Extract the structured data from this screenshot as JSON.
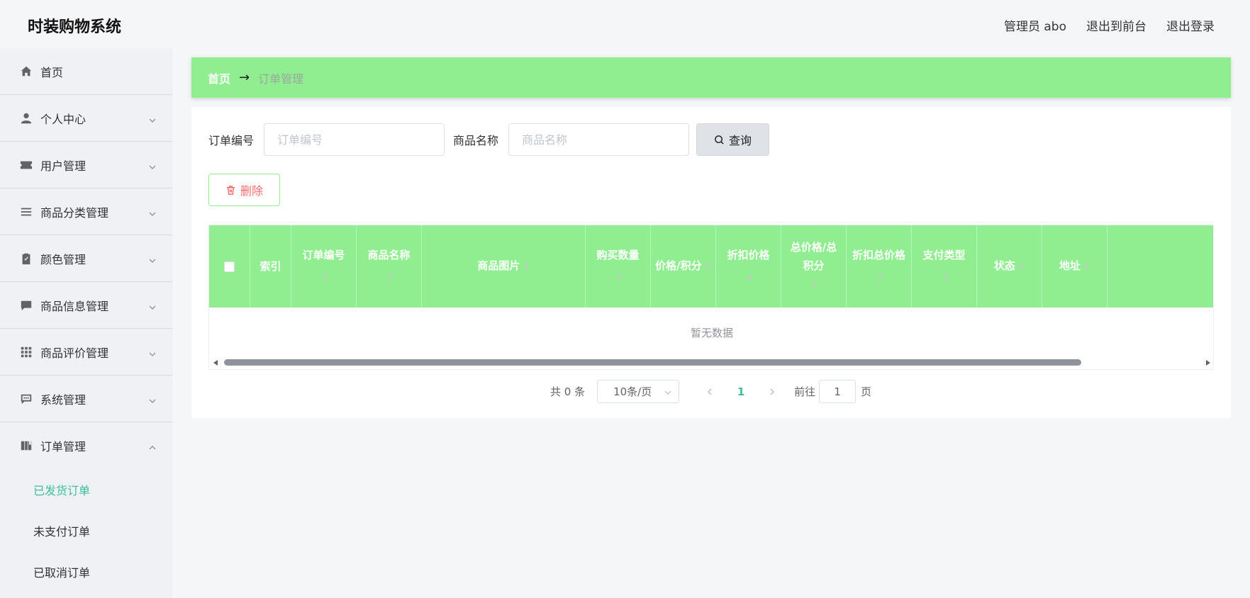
{
  "app": {
    "title": "时装购物系统"
  },
  "header": {
    "links": [
      "管理员 abo",
      "退出到前台",
      "退出登录"
    ]
  },
  "sidebar": {
    "items": [
      {
        "label": "首页",
        "icon": "home-icon",
        "expandable": false
      },
      {
        "label": "个人中心",
        "icon": "user-icon",
        "expandable": true
      },
      {
        "label": "用户管理",
        "icon": "ticket-icon",
        "expandable": true
      },
      {
        "label": "商品分类管理",
        "icon": "list-icon",
        "expandable": true
      },
      {
        "label": "颜色管理",
        "icon": "clipboard-check-icon",
        "expandable": true
      },
      {
        "label": "商品信息管理",
        "icon": "message-icon",
        "expandable": true
      },
      {
        "label": "商品评价管理",
        "icon": "grid-icon",
        "expandable": true
      },
      {
        "label": "系统管理",
        "icon": "chat-dots-icon",
        "expandable": true
      },
      {
        "label": "订单管理",
        "icon": "book-icon",
        "expandable": true,
        "expanded": true
      }
    ],
    "subitems": [
      {
        "label": "已发货订单",
        "active": true
      },
      {
        "label": "未支付订单",
        "active": false
      },
      {
        "label": "已取消订单",
        "active": false
      }
    ]
  },
  "breadcrumb": {
    "home": "首页",
    "separator": "→",
    "current": "订单管理"
  },
  "search": {
    "order_no_label": "订单编号",
    "order_no_placeholder": "订单编号",
    "product_name_label": "商品名称",
    "product_name_placeholder": "商品名称",
    "query_label": "查询"
  },
  "actions": {
    "delete_label": "删除"
  },
  "table": {
    "columns": [
      {
        "label": "",
        "type": "checkbox",
        "sortable": false
      },
      {
        "label": "索引",
        "sortable": false
      },
      {
        "label": "订单编号",
        "sortable": true
      },
      {
        "label": "商品名称",
        "sortable": true
      },
      {
        "label": "商品图片",
        "sortable": true
      },
      {
        "label": "购买数量",
        "sortable": true
      },
      {
        "label": "价格/积分",
        "sortable": true
      },
      {
        "label": "折扣价格",
        "sortable": true
      },
      {
        "label": "总价格/总积分",
        "sortable": true
      },
      {
        "label": "折扣总价格",
        "sortable": true
      },
      {
        "label": "支付类型",
        "sortable": true
      },
      {
        "label": "状态",
        "sortable": true
      },
      {
        "label": "地址",
        "sortable": true
      },
      {
        "label": "",
        "sortable": false
      }
    ],
    "empty_text": "暂无数据"
  },
  "pagination": {
    "total_text": "共 0 条",
    "page_size": "10条/页",
    "current_page": "1",
    "goto_prefix": "前往",
    "goto_value": "1",
    "goto_suffix": "页"
  },
  "colors": {
    "accent_green": "#90ee90",
    "active_text": "#3bbf9c",
    "danger": "#f56c6c"
  }
}
